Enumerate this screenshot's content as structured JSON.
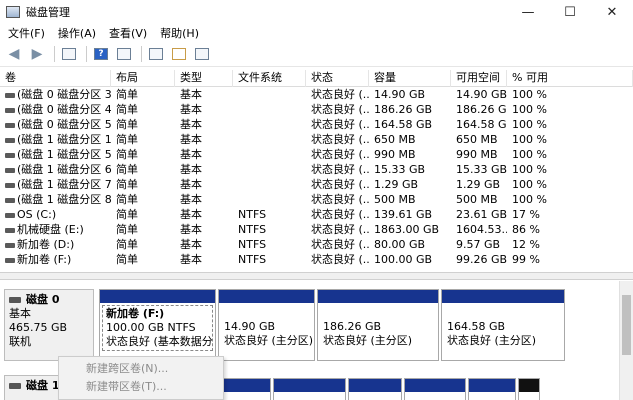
{
  "window": {
    "title": "磁盘管理",
    "minimize": "—",
    "maximize": "☐",
    "close": "✕"
  },
  "menu": [
    "文件(F)",
    "操作(A)",
    "查看(V)",
    "帮助(H)"
  ],
  "toolbar_icons": [
    "back-icon",
    "forward-icon",
    "properties-icon",
    "help-icon",
    "list-icon",
    "connect-icon",
    "check-icon",
    "console-icon"
  ],
  "columns": [
    "卷",
    "布局",
    "类型",
    "文件系统",
    "状态",
    "容量",
    "可用空间",
    "% 可用"
  ],
  "volumes": [
    [
      "(磁盘 0 磁盘分区 3)",
      "简单",
      "基本",
      "",
      "状态良好 (...",
      "14.90 GB",
      "14.90 GB",
      "100 %"
    ],
    [
      "(磁盘 0 磁盘分区 4)",
      "简单",
      "基本",
      "",
      "状态良好 (...",
      "186.26 GB",
      "186.26 GB",
      "100 %"
    ],
    [
      "(磁盘 0 磁盘分区 5)",
      "简单",
      "基本",
      "",
      "状态良好 (...",
      "164.58 GB",
      "164.58 GB",
      "100 %"
    ],
    [
      "(磁盘 1 磁盘分区 1)",
      "简单",
      "基本",
      "",
      "状态良好 (...",
      "650 MB",
      "650 MB",
      "100 %"
    ],
    [
      "(磁盘 1 磁盘分区 5)",
      "简单",
      "基本",
      "",
      "状态良好 (...",
      "990 MB",
      "990 MB",
      "100 %"
    ],
    [
      "(磁盘 1 磁盘分区 6)",
      "简单",
      "基本",
      "",
      "状态良好 (...",
      "15.33 GB",
      "15.33 GB",
      "100 %"
    ],
    [
      "(磁盘 1 磁盘分区 7)",
      "简单",
      "基本",
      "",
      "状态良好 (...",
      "1.29 GB",
      "1.29 GB",
      "100 %"
    ],
    [
      "(磁盘 1 磁盘分区 8)",
      "简单",
      "基本",
      "",
      "状态良好 (...",
      "500 MB",
      "500 MB",
      "100 %"
    ],
    [
      "OS (C:)",
      "简单",
      "基本",
      "NTFS",
      "状态良好 (...",
      "139.61 GB",
      "23.61 GB",
      "17 %"
    ],
    [
      "机械硬盘 (E:)",
      "简单",
      "基本",
      "NTFS",
      "状态良好 (...",
      "1863.00 GB",
      "1604.53...",
      "86 %"
    ],
    [
      "新加卷 (D:)",
      "简单",
      "基本",
      "NTFS",
      "状态良好 (...",
      "80.00 GB",
      "9.57 GB",
      "12 %"
    ],
    [
      "新加卷 (F:)",
      "简单",
      "基本",
      "NTFS",
      "状态良好 (...",
      "100.00 GB",
      "99.26 GB",
      "99 %"
    ]
  ],
  "disk0": {
    "name": "磁盘 0",
    "type": "基本",
    "size": "465.75 GB",
    "status": "联机",
    "partitions": [
      {
        "name": "新加卷  (F:)",
        "size": "100.00 GB NTFS",
        "status": "状态良好 (基本数据分区"
      },
      {
        "name": "",
        "size": "14.90 GB",
        "status": "状态良好 (主分区)"
      },
      {
        "name": "",
        "size": "186.26 GB",
        "status": "状态良好 (主分区)"
      },
      {
        "name": "",
        "size": "164.58 GB",
        "status": "状态良好 (主分区)"
      }
    ]
  },
  "disk1": {
    "name": "磁盘 1"
  },
  "context_menu": [
    "新建跨区卷(N)...",
    "新建带区卷(T)..."
  ],
  "colors": {
    "partition_stripe": "#17348f",
    "unallocated_stripe": "#111111"
  }
}
